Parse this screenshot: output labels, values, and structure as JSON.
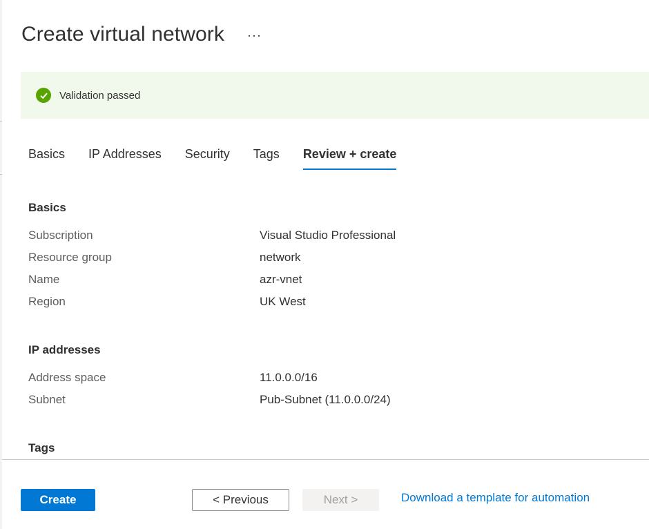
{
  "header": {
    "title": "Create virtual network",
    "more_label": "···"
  },
  "banner": {
    "text": "Validation passed",
    "icon": "check-circle-icon",
    "color": "#57a300"
  },
  "tabs": [
    {
      "label": "Basics",
      "active": false
    },
    {
      "label": "IP Addresses",
      "active": false
    },
    {
      "label": "Security",
      "active": false
    },
    {
      "label": "Tags",
      "active": false
    },
    {
      "label": "Review + create",
      "active": true
    }
  ],
  "sections": {
    "basics": {
      "title": "Basics",
      "rows": [
        {
          "key": "Subscription",
          "value": "Visual Studio Professional"
        },
        {
          "key": "Resource group",
          "value": "network"
        },
        {
          "key": "Name",
          "value": "azr-vnet"
        },
        {
          "key": "Region",
          "value": "UK West"
        }
      ]
    },
    "ip": {
      "title": "IP addresses",
      "rows": [
        {
          "key": "Address space",
          "value": "11.0.0.0/16"
        },
        {
          "key": "Subnet",
          "value": "Pub-Subnet (11.0.0.0/24)"
        }
      ]
    },
    "tags": {
      "title": "Tags"
    }
  },
  "footer": {
    "create_label": "Create",
    "previous_label": "< Previous",
    "next_label": "Next >",
    "download_label": "Download a template for automation"
  },
  "colors": {
    "accent": "#0078d4",
    "success": "#57a300",
    "banner_bg": "#f1f8ec"
  }
}
